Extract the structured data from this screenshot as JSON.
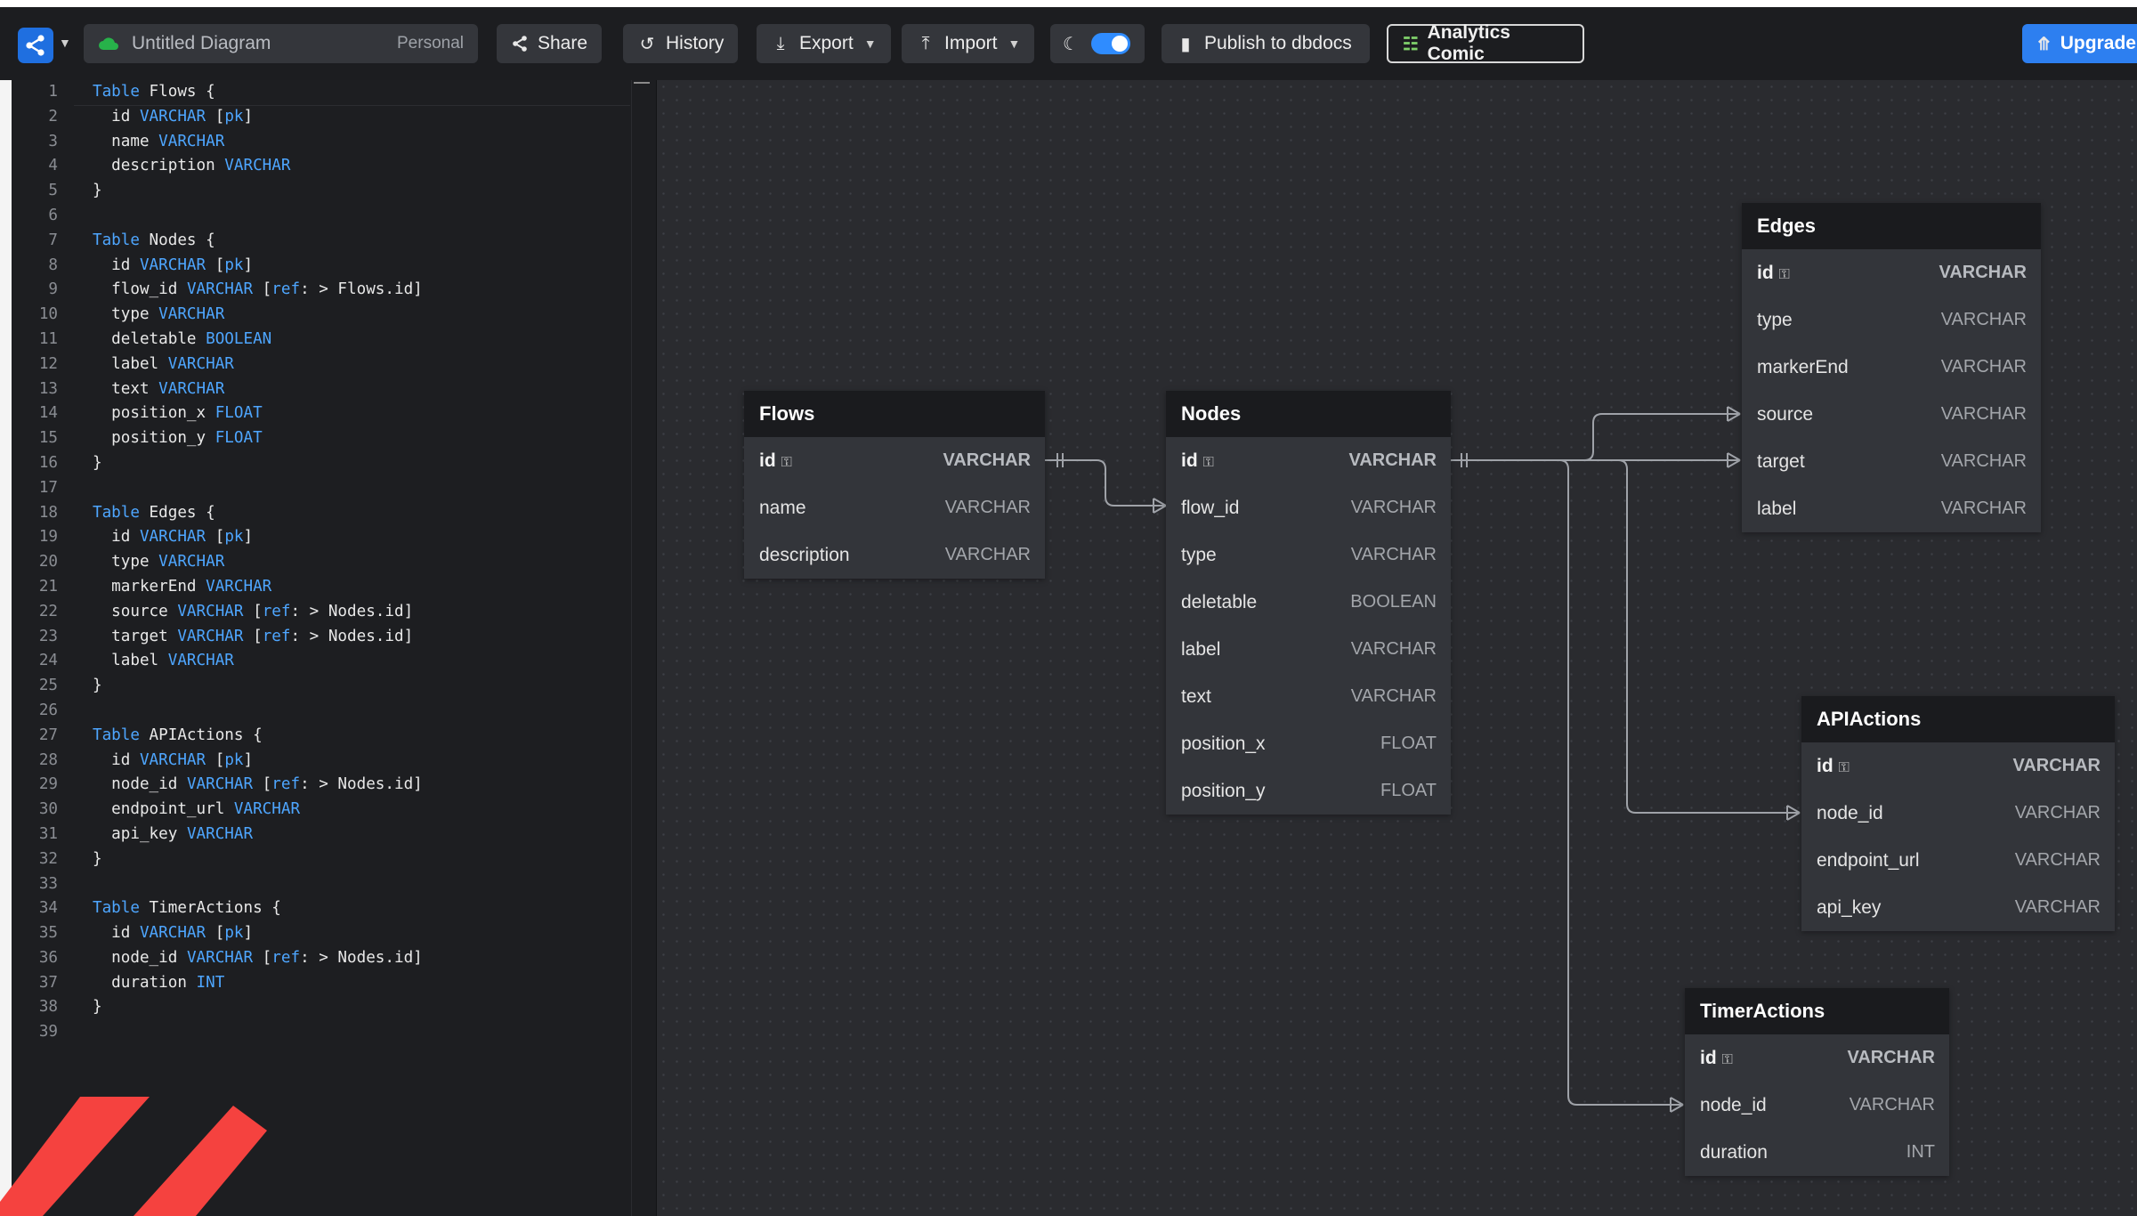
{
  "topbar": {
    "title": "Untitled Diagram",
    "workspace": "Personal",
    "share": "Share",
    "history": "History",
    "export": "Export",
    "import": "Import",
    "publish": "Publish to dbdocs",
    "analytics": "Analytics Comic",
    "upgrade": "Upgrade"
  },
  "editor": {
    "lines": [
      "Table Flows {",
      "  id VARCHAR [pk]",
      "  name VARCHAR",
      "  description VARCHAR",
      "}",
      "",
      "Table Nodes {",
      "  id VARCHAR [pk]",
      "  flow_id VARCHAR [ref: > Flows.id]",
      "  type VARCHAR",
      "  deletable BOOLEAN",
      "  label VARCHAR",
      "  text VARCHAR",
      "  position_x FLOAT",
      "  position_y FLOAT",
      "}",
      "",
      "Table Edges {",
      "  id VARCHAR [pk]",
      "  type VARCHAR",
      "  markerEnd VARCHAR",
      "  source VARCHAR [ref: > Nodes.id]",
      "  target VARCHAR [ref: > Nodes.id]",
      "  label VARCHAR",
      "}",
      "",
      "Table APIActions {",
      "  id VARCHAR [pk]",
      "  node_id VARCHAR [ref: > Nodes.id]",
      "  endpoint_url VARCHAR",
      "  api_key VARCHAR",
      "}",
      "",
      "Table TimerActions {",
      "  id VARCHAR [pk]",
      "  node_id VARCHAR [ref: > Nodes.id]",
      "  duration INT",
      "}",
      ""
    ]
  },
  "tables": {
    "flows": {
      "name": "Flows",
      "fields": [
        {
          "name": "id",
          "type": "VARCHAR",
          "pk": true
        },
        {
          "name": "name",
          "type": "VARCHAR"
        },
        {
          "name": "description",
          "type": "VARCHAR"
        }
      ]
    },
    "nodes": {
      "name": "Nodes",
      "fields": [
        {
          "name": "id",
          "type": "VARCHAR",
          "pk": true
        },
        {
          "name": "flow_id",
          "type": "VARCHAR"
        },
        {
          "name": "type",
          "type": "VARCHAR"
        },
        {
          "name": "deletable",
          "type": "BOOLEAN"
        },
        {
          "name": "label",
          "type": "VARCHAR"
        },
        {
          "name": "text",
          "type": "VARCHAR"
        },
        {
          "name": "position_x",
          "type": "FLOAT"
        },
        {
          "name": "position_y",
          "type": "FLOAT"
        }
      ]
    },
    "edges": {
      "name": "Edges",
      "fields": [
        {
          "name": "id",
          "type": "VARCHAR",
          "pk": true
        },
        {
          "name": "type",
          "type": "VARCHAR"
        },
        {
          "name": "markerEnd",
          "type": "VARCHAR"
        },
        {
          "name": "source",
          "type": "VARCHAR"
        },
        {
          "name": "target",
          "type": "VARCHAR"
        },
        {
          "name": "label",
          "type": "VARCHAR"
        }
      ]
    },
    "apiactions": {
      "name": "APIActions",
      "fields": [
        {
          "name": "id",
          "type": "VARCHAR",
          "pk": true
        },
        {
          "name": "node_id",
          "type": "VARCHAR"
        },
        {
          "name": "endpoint_url",
          "type": "VARCHAR"
        },
        {
          "name": "api_key",
          "type": "VARCHAR"
        }
      ]
    },
    "timeractions": {
      "name": "TimerActions",
      "fields": [
        {
          "name": "id",
          "type": "VARCHAR",
          "pk": true
        },
        {
          "name": "node_id",
          "type": "VARCHAR"
        },
        {
          "name": "duration",
          "type": "INT"
        }
      ]
    }
  },
  "colors": {
    "accent": "#2d7ff0",
    "keyword": "#4ea6ff",
    "stripe": "#f5423f"
  }
}
